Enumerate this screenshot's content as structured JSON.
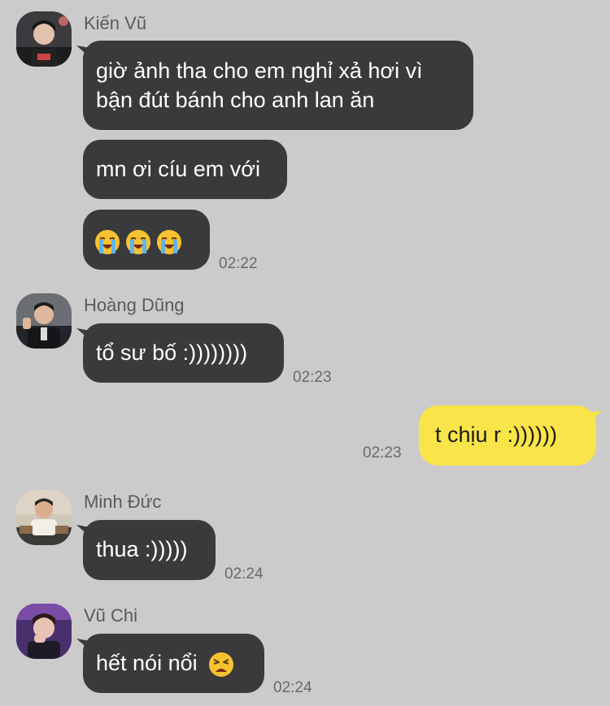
{
  "chat": {
    "messages": [
      {
        "sender": "Kiến Vũ",
        "avatar": "avatar-kien-vu",
        "bubbles": [
          {
            "lines": [
              "giờ ảnh tha cho em nghỉ xả hơi vì",
              "bận đút bánh cho anh lan ăn"
            ]
          },
          {
            "lines": [
              "mn ơi cíu em với"
            ]
          },
          {
            "emoji": [
              "loudly-crying-face",
              "loudly-crying-face",
              "loudly-crying-face"
            ]
          }
        ],
        "time": "02:22"
      },
      {
        "sender": "Hoàng Dũng",
        "avatar": "avatar-hoang-dung",
        "bubbles": [
          {
            "lines": [
              "tổ sư bố :))))))))"
            ]
          }
        ],
        "time": "02:23"
      },
      {
        "sender": "me",
        "bubbles": [
          {
            "lines": [
              "t chịu r :))))))"
            ]
          }
        ],
        "time": "02:23"
      },
      {
        "sender": "Minh Đức",
        "avatar": "avatar-minh-duc",
        "bubbles": [
          {
            "lines": [
              "thua :)))))"
            ]
          }
        ],
        "time": "02:24"
      },
      {
        "sender": "Vũ Chi",
        "avatar": "avatar-vu-chi",
        "bubbles": [
          {
            "text": "hết nói nổi",
            "emoji": "weary-face"
          }
        ],
        "time": "02:24"
      }
    ]
  },
  "colors": {
    "background": "#cbcbcb",
    "incoming_bubble": "#3a3a3c",
    "outgoing_bubble": "#f9e449"
  }
}
